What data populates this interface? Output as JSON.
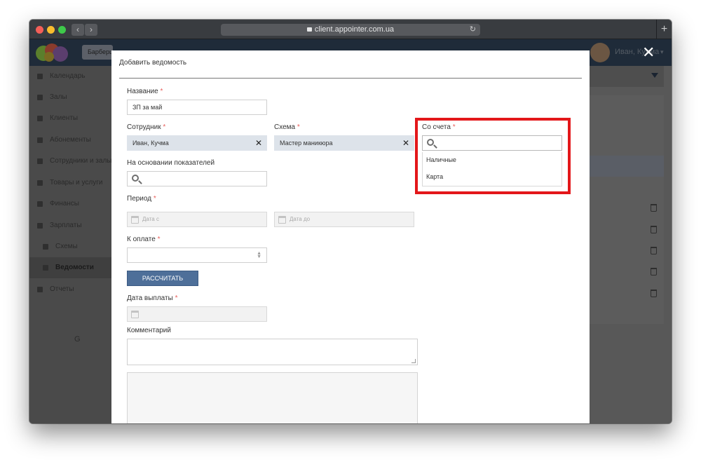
{
  "browser": {
    "url": "client.appointer.com.ua"
  },
  "app": {
    "company": "Барбершоп",
    "user_name": "Иван, Кучма",
    "sidebar": [
      {
        "label": "Календарь",
        "icon": "calendar-icon"
      },
      {
        "label": "Залы",
        "icon": "bookmark-icon"
      },
      {
        "label": "Клиенты",
        "icon": "users-icon"
      },
      {
        "label": "Абонементы",
        "icon": "card-icon"
      },
      {
        "label": "Сотрудники и залы",
        "icon": "staff-icon"
      },
      {
        "label": "Товары и услуги",
        "icon": "cart-icon"
      },
      {
        "label": "Финансы",
        "icon": "money-icon"
      },
      {
        "label": "Зарплаты",
        "icon": "wallet-icon"
      },
      {
        "label": "Схемы",
        "icon": "scheme-icon"
      },
      {
        "label": "Ведомости",
        "icon": "list-icon"
      },
      {
        "label": "Отчеты",
        "icon": "report-icon"
      }
    ],
    "collapse_label": "G"
  },
  "modal": {
    "title": "Добавить ведомость",
    "name": {
      "label": "Название",
      "value": "ЗП за май"
    },
    "employee": {
      "label": "Сотрудник",
      "value": "Иван, Кучма"
    },
    "scheme": {
      "label": "Схема",
      "value": "Мастер маникюра"
    },
    "account": {
      "label": "Со счета",
      "value": "",
      "options": [
        "Наличные",
        "Карта"
      ]
    },
    "indicators": {
      "label": "На основании показателей",
      "value": ""
    },
    "period": {
      "label": "Период",
      "from_placeholder": "Дата с",
      "to_placeholder": "Дата до"
    },
    "to_pay": {
      "label": "К оплате",
      "value": ""
    },
    "calculate_label": "РАССЧИТАТЬ",
    "pay_date": {
      "label": "Дата выплаты"
    },
    "comment": {
      "label": "Комментарий"
    },
    "required_mark": "*"
  },
  "colors": {
    "highlight": "#e3171a",
    "calculate_button": "#4e6f99",
    "tag_bg": "#dde3ea"
  }
}
